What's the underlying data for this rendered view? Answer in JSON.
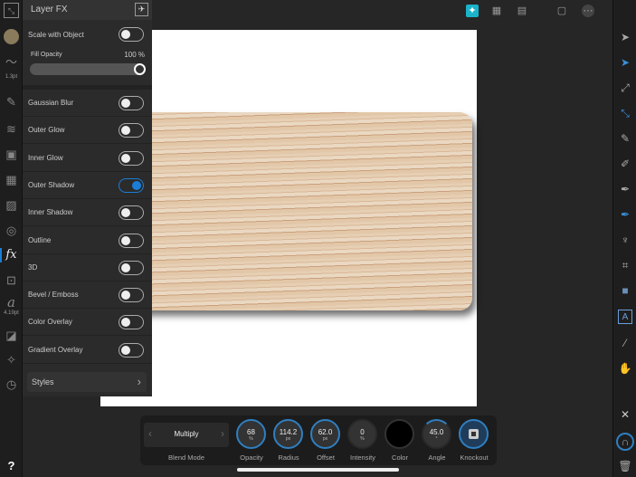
{
  "panel": {
    "title": "Layer FX",
    "scale_with_object": "Scale with Object",
    "fill_opacity_label": "Fill Opacity",
    "fill_opacity_value": "100 %",
    "fill_opacity": 1.0,
    "effects": [
      {
        "label": "Gaussian Blur",
        "on": false
      },
      {
        "label": "Outer Glow",
        "on": false
      },
      {
        "label": "Inner Glow",
        "on": false
      },
      {
        "label": "Outer Shadow",
        "on": true
      },
      {
        "label": "Inner Shadow",
        "on": false
      },
      {
        "label": "Outline",
        "on": false
      },
      {
        "label": "3D",
        "on": false
      },
      {
        "label": "Bevel / Emboss",
        "on": false
      },
      {
        "label": "Color Overlay",
        "on": false
      },
      {
        "label": "Gradient Overlay",
        "on": false
      }
    ],
    "styles": "Styles"
  },
  "left_toolbar": {
    "brush_size": "1.3pt",
    "font_size": "4.19pt",
    "fx": "fx",
    "char": "a",
    "help": "?"
  },
  "bottom": {
    "blend_mode": "Multiply",
    "blend_label": "Blend Mode",
    "opacity": {
      "value": "68",
      "unit": "%",
      "label": "Opacity"
    },
    "radius": {
      "value": "114.2",
      "unit": "px",
      "label": "Radius"
    },
    "offset": {
      "value": "62.0",
      "unit": "px",
      "label": "Offset"
    },
    "intensity": {
      "value": "0",
      "unit": "%",
      "label": "Intensity"
    },
    "color": {
      "label": "Color",
      "value": "#000000"
    },
    "angle": {
      "value": "45.0",
      "unit": "°",
      "label": "Angle"
    },
    "knockout": {
      "label": "Knockout"
    }
  },
  "colors": {
    "accent": "#1a7ed6",
    "swatch": "#8a7b5c"
  }
}
